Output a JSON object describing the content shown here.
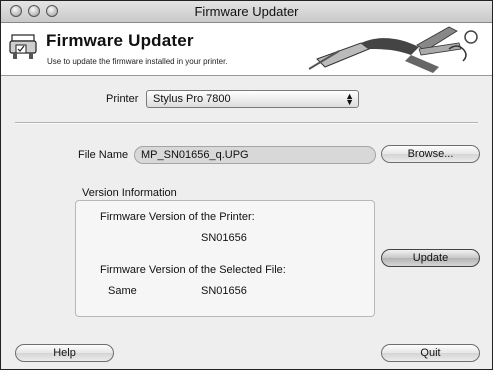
{
  "window": {
    "title": "Firmware Updater"
  },
  "header": {
    "title": "Firmware Updater",
    "description": "Use to update the firmware installed in your printer."
  },
  "printer": {
    "label": "Printer",
    "selected": "Stylus Pro 7800"
  },
  "file": {
    "label": "File Name",
    "value": "MP_SN01656_q.UPG"
  },
  "buttons": {
    "browse": "Browse...",
    "update": "Update",
    "help": "Help",
    "quit": "Quit"
  },
  "version_info": {
    "legend": "Version Information",
    "printer_label": "Firmware Version of the Printer:",
    "printer_version": "SN01656",
    "file_label": "Firmware Version of the Selected File:",
    "comparison": "Same",
    "file_version": "SN01656"
  },
  "icons": {
    "app": "printer-icon",
    "banner": "multi-tool-icon"
  }
}
